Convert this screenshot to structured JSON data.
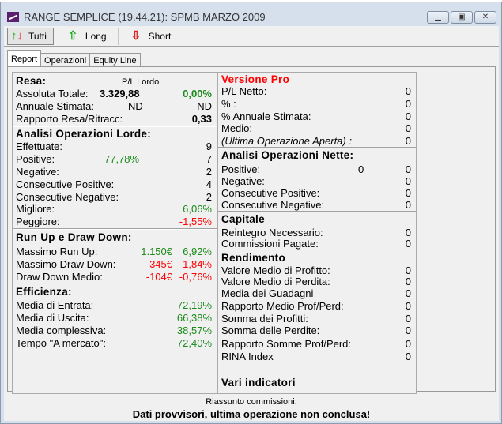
{
  "window": {
    "title": "RANGE SEMPLICE (19.44.21): SPMB MARZO 2009",
    "minimize": "▁",
    "maximize": "▣",
    "close": "✕"
  },
  "toolbar": {
    "tutti": "Tutti",
    "long": "Long",
    "short": "Short"
  },
  "tabs": [
    "Report",
    "Operazioni",
    "Equity Line"
  ],
  "left": {
    "resa": {
      "title": "Resa:",
      "col_header": "P/L Lordo",
      "assoluta": {
        "label": "Assoluta Totale:",
        "value": "3.329,88",
        "pct": "0,00%"
      },
      "annuale": {
        "label": "Annuale Stimata:",
        "value": "ND",
        "pct": "ND"
      },
      "rapporto": {
        "label": "Rapporto Resa/Ritracc:",
        "value": "0,33"
      }
    },
    "lorde": {
      "title": "Analisi Operazioni Lorde:",
      "rows": [
        {
          "label": "Effettuate:",
          "value": "9"
        },
        {
          "label": "Positive:",
          "mid": "77,78%",
          "value": "7"
        },
        {
          "label": "Negative:",
          "value": "2"
        },
        {
          "label": "Consecutive Positive:",
          "value": "4"
        },
        {
          "label": "Consecutive Negative:",
          "value": "2"
        },
        {
          "label": "Migliore:",
          "value": "6,06%"
        },
        {
          "label": "Peggiore:",
          "value": "-1,55%"
        }
      ]
    },
    "runup": {
      "title": "Run Up e Draw Down:",
      "rows": [
        {
          "label": "Massimo Run Up:",
          "eur": "1.150€",
          "pct": "6,92%"
        },
        {
          "label": "Massimo Draw Down:",
          "eur": "-345€",
          "pct": "-1,84%"
        },
        {
          "label": "Draw Down Medio:",
          "eur": "-104€",
          "pct": "-0,76%"
        }
      ]
    },
    "efficienza": {
      "title": "Efficienza:",
      "rows": [
        {
          "label": "Media di Entrata:",
          "value": "72,19%"
        },
        {
          "label": "Media di Uscita:",
          "value": "66,38%"
        },
        {
          "label": "Media complessiva:",
          "value": "38,57%"
        },
        {
          "label": "Tempo \"A mercato\":",
          "value": "72,40%"
        }
      ]
    }
  },
  "right": {
    "pro": {
      "title": "Versione Pro",
      "rows": [
        {
          "label": "P/L Netto:",
          "value": "0"
        },
        {
          "label": "% :",
          "value": "0"
        },
        {
          "label": "% Annuale Stimata:",
          "value": "0"
        },
        {
          "label": "Medio:",
          "value": "0"
        },
        {
          "label": "(Ultima Operazione Aperta) :",
          "value": "0"
        }
      ]
    },
    "nette": {
      "title": "Analisi Operazioni Nette:",
      "rows": [
        {
          "label": "Positive:",
          "mid": "0",
          "value": "0"
        },
        {
          "label": "Negative:",
          "value": "0"
        },
        {
          "label": "Consecutive Positive:",
          "value": "0"
        },
        {
          "label": "Consecutive Negative:",
          "value": "0"
        }
      ]
    },
    "capitale": {
      "title": "Capitale",
      "rows": [
        {
          "label": "Reintegro Necessario:",
          "value": "0"
        },
        {
          "label": "Commissioni Pagate:",
          "value": "0"
        }
      ]
    },
    "rendimento": {
      "title": "Rendimento",
      "rows": [
        {
          "label": "Valore Medio di Profitto:",
          "value": "0"
        },
        {
          "label": "Valore Medio di Perdita:",
          "value": "0"
        },
        {
          "label": "Media dei Guadagni",
          "value": "0"
        },
        {
          "label": "Rapporto Medio Prof/Perd:",
          "value": "0"
        },
        {
          "label": "Somma dei Profitti:",
          "value": "0"
        },
        {
          "label": "Somma delle Perdite:",
          "value": "0"
        },
        {
          "label": "Rapporto Somme Prof/Perd:",
          "value": "0"
        },
        {
          "label": "RINA Index",
          "value": "0"
        }
      ]
    },
    "vari": {
      "title": "Vari indicatori"
    }
  },
  "status": {
    "line1": "Riassunto commissioni:",
    "line2": "Dati provvisori, ultima operazione non conclusa!"
  },
  "colors": {
    "positive": "#1a8a1a",
    "negative": "#ff0000",
    "pro_title": "#ff0000"
  }
}
